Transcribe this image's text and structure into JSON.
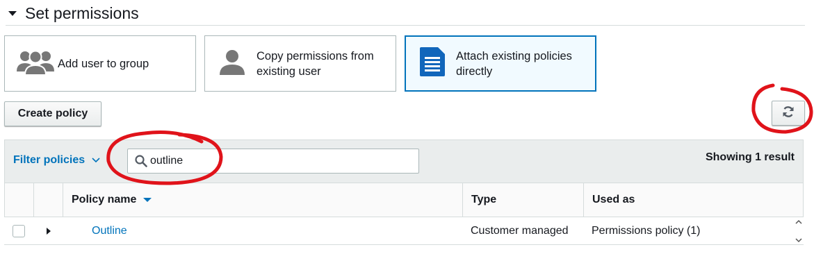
{
  "section": {
    "title": "Set permissions"
  },
  "options": [
    {
      "label_line1": "Add user to group",
      "label_line2": "",
      "icon": "users-group-icon"
    },
    {
      "label_line1": "Copy permissions from",
      "label_line2": "existing user",
      "icon": "user-icon"
    },
    {
      "label_line1": "Attach existing policies",
      "label_line2": "directly",
      "icon": "document-icon",
      "selected": true
    }
  ],
  "toolbar": {
    "create_policy_label": "Create policy",
    "refresh_icon": "refresh-icon"
  },
  "filter": {
    "dropdown_label": "Filter policies",
    "search_value": "outline",
    "result_count": "Showing 1 result"
  },
  "table": {
    "columns": [
      "Policy name",
      "Type",
      "Used as"
    ],
    "rows": [
      {
        "policy_name": "Outline",
        "type": "Customer managed",
        "used_as": "Permissions policy (1)"
      }
    ]
  },
  "colors": {
    "accent": "#0073bb",
    "selected_bg": "#f1faff",
    "annotation": "#e0131a"
  }
}
